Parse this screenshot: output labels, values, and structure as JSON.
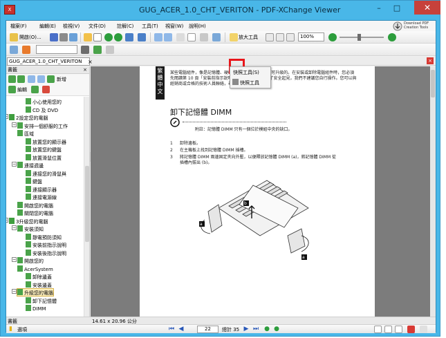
{
  "window": {
    "title": "GUG_ACER_1.0_CHT_VERITON - PDF-XChange Viewer",
    "minimize": "–",
    "maximize": "□",
    "close": "✕"
  },
  "menubar": {
    "items": [
      "檔案(F)",
      "編輯(E)",
      "檢視(V)",
      "文件(D)",
      "註解(C)",
      "工具(T)",
      "視窗(W)",
      "說明(H)"
    ],
    "logo_line1": "Download PDF",
    "logo_line2": "Creation Tools"
  },
  "toolbar1": {
    "open_label": "開啟(O)...",
    "zoom_tool_label": "放大工具",
    "zoom_value": "100%"
  },
  "toolbar2": {
    "input_value": ""
  },
  "snapshot_menu": {
    "items": [
      "快照工具(S)",
      "快照工具"
    ]
  },
  "document_tab": {
    "label": "GUG_ACER_1.0_CHT_VERITON",
    "close": "×"
  },
  "bookmarks_panel": {
    "title": "書籤",
    "close": "×",
    "tool_new": "新增",
    "tool_edit": "編輯",
    "items": [
      {
        "label": "小心使用您的",
        "level": 2,
        "expander": ""
      },
      {
        "label": "CD 及 DVD",
        "level": 2,
        "expander": ""
      },
      {
        "label": "2設定您的電腦",
        "level": 0,
        "expander": "−"
      },
      {
        "label": "安排一個舒服的工作",
        "level": 1,
        "expander": "−"
      },
      {
        "label": "區域",
        "level": 1,
        "expander": ""
      },
      {
        "label": "放置您的顯示器",
        "level": 2,
        "expander": ""
      },
      {
        "label": "放置您的鍵盤",
        "level": 2,
        "expander": ""
      },
      {
        "label": "放置滑鼠位置",
        "level": 2,
        "expander": ""
      },
      {
        "label": "連接週邊",
        "level": 1,
        "expander": "−"
      },
      {
        "label": "連接您的滑鼠與",
        "level": 2,
        "expander": ""
      },
      {
        "label": "鍵盤",
        "level": 2,
        "expander": ""
      },
      {
        "label": "連接顯示器",
        "level": 2,
        "expander": ""
      },
      {
        "label": "連接電源線",
        "level": 2,
        "expander": ""
      },
      {
        "label": "開啟您的電腦",
        "level": 1,
        "expander": ""
      },
      {
        "label": "關閉您的電腦",
        "level": 1,
        "expander": ""
      },
      {
        "label": "3升級您的電腦",
        "level": 0,
        "expander": "−"
      },
      {
        "label": "安裝須知",
        "level": 1,
        "expander": "−"
      },
      {
        "label": "靜電預防須知",
        "level": 2,
        "expander": ""
      },
      {
        "label": "安裝前指示說明",
        "level": 2,
        "expander": ""
      },
      {
        "label": "安裝後指示說明",
        "level": 2,
        "expander": ""
      },
      {
        "label": "開啟您的",
        "level": 1,
        "expander": "−"
      },
      {
        "label": "AcerSystem",
        "level": 1,
        "expander": ""
      },
      {
        "label": "卸除邊蓋",
        "level": 2,
        "expander": ""
      },
      {
        "label": "安裝邊蓋",
        "level": 2,
        "expander": ""
      },
      {
        "label": "升級您的電腦",
        "level": 1,
        "expander": "−"
      },
      {
        "label": "卸下記憶體",
        "level": 2,
        "expander": ""
      },
      {
        "label": "DIMM",
        "level": 2,
        "expander": ""
      }
    ]
  },
  "page": {
    "side_tab": "繁體中文",
    "intro": "某些電腦組件，像是記憶體、硬碟、CPU 及擴充卡都是可升級的。在安裝或卸除電腦組件時，您必須先閱讀第 10 頁「安裝前指示說明」的內容。不過，為了安全起見，我們不建議您自行操作。您可以與經銷商或合格的技術人員聯絡，尋求升級的協助。",
    "heading": "卸下記憶體 DIMM",
    "note": "附註：記憶體 DIMM 只有一個位於模組中央的缺口。",
    "steps": [
      {
        "num": "1",
        "text": "卸除邊板。"
      },
      {
        "num": "2",
        "text": "在主機板上找到記憶體 DIMM 插槽。"
      },
      {
        "num": "3",
        "text": "將記憶體 DIMM 兩邊固定夾向外壓，以便釋放記憶體 DIMM (a)，將記憶體 DIMM 從插槽內拔出 (b)。"
      }
    ],
    "callouts": [
      "a",
      "b",
      "a"
    ]
  },
  "statusbar": {
    "page_size": "14.61 x 20.96 公分"
  },
  "bottombar": {
    "options_label": "選項",
    "current_page": "22",
    "total_pages": "總計 35"
  }
}
